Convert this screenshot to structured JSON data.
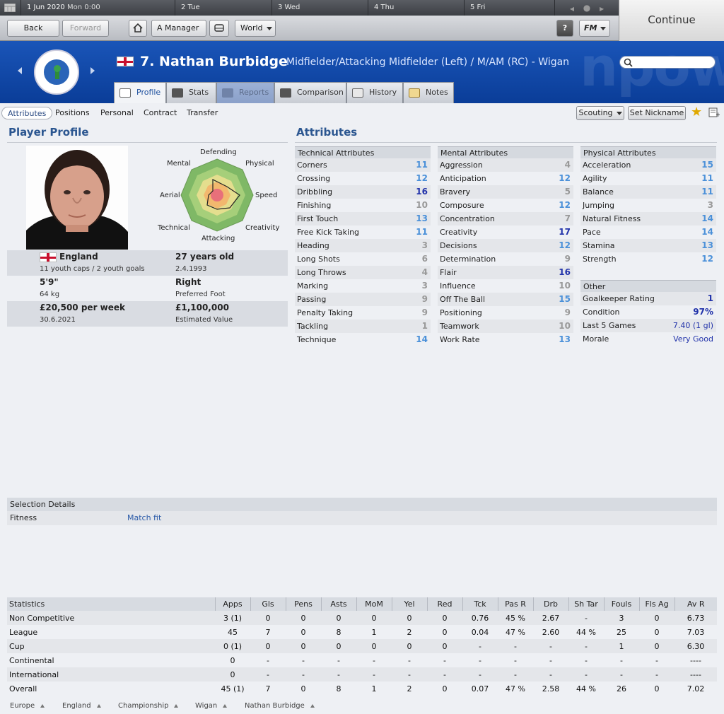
{
  "topbar": {
    "date": "1 Jun 2020",
    "time": "Mon 0:00",
    "days": [
      "2 Tue",
      "3 Wed",
      "4 Thu",
      "5 Fri"
    ],
    "continue_label": "Continue"
  },
  "nav": {
    "back": "Back",
    "forward": "Forward",
    "manager": "A Manager",
    "world": "World",
    "help": "?",
    "fm": "FM"
  },
  "header": {
    "club_crest": "WIGAN ATHLETIC",
    "player_title": "7. Nathan Burbidge",
    "position": "Midfielder/Attacking Midfielder (Left) / M/AM (RC) - Wigan",
    "watermark": "npowe",
    "tabs": [
      "Profile",
      "Stats",
      "Reports",
      "Comparison",
      "History",
      "Notes"
    ]
  },
  "subtabs": {
    "items": [
      "Attributes",
      "Positions",
      "Personal",
      "Contract",
      "Transfer"
    ],
    "scouting": "Scouting",
    "set_nickname": "Set Nickname"
  },
  "profile": {
    "title": "Player Profile",
    "radar_labels": {
      "defending": "Defending",
      "physical": "Physical",
      "speed": "Speed",
      "creativity": "Creativity",
      "attacking": "Attacking",
      "technical": "Technical",
      "aerial": "Aerial",
      "mental": "Mental"
    },
    "nationality": "England",
    "caps": "11 youth caps / 2 youth goals",
    "age": "27 years old",
    "dob": "2.4.1993",
    "height": "5'9\"",
    "weight": "64 kg",
    "foot": "Right",
    "foot_label": "Preferred Foot",
    "wage": "£20,500 per week",
    "contract_end": "30.6.2021",
    "value": "£1,100,000",
    "value_label": "Estimated Value"
  },
  "attributes": {
    "title": "Attributes",
    "technical": {
      "header": "Technical Attributes",
      "rows": [
        {
          "name": "Corners",
          "value": "11"
        },
        {
          "name": "Crossing",
          "value": "12"
        },
        {
          "name": "Dribbling",
          "value": "16"
        },
        {
          "name": "Finishing",
          "value": "10"
        },
        {
          "name": "First Touch",
          "value": "13"
        },
        {
          "name": "Free Kick Taking",
          "value": "11"
        },
        {
          "name": "Heading",
          "value": "3"
        },
        {
          "name": "Long Shots",
          "value": "6"
        },
        {
          "name": "Long Throws",
          "value": "4"
        },
        {
          "name": "Marking",
          "value": "3"
        },
        {
          "name": "Passing",
          "value": "9"
        },
        {
          "name": "Penalty Taking",
          "value": "9"
        },
        {
          "name": "Tackling",
          "value": "1"
        },
        {
          "name": "Technique",
          "value": "14"
        }
      ]
    },
    "mental": {
      "header": "Mental Attributes",
      "rows": [
        {
          "name": "Aggression",
          "value": "4"
        },
        {
          "name": "Anticipation",
          "value": "12"
        },
        {
          "name": "Bravery",
          "value": "5"
        },
        {
          "name": "Composure",
          "value": "12"
        },
        {
          "name": "Concentration",
          "value": "7"
        },
        {
          "name": "Creativity",
          "value": "17"
        },
        {
          "name": "Decisions",
          "value": "12"
        },
        {
          "name": "Determination",
          "value": "9"
        },
        {
          "name": "Flair",
          "value": "16"
        },
        {
          "name": "Influence",
          "value": "10"
        },
        {
          "name": "Off The Ball",
          "value": "15"
        },
        {
          "name": "Positioning",
          "value": "9"
        },
        {
          "name": "Teamwork",
          "value": "10"
        },
        {
          "name": "Work Rate",
          "value": "13"
        }
      ]
    },
    "physical": {
      "header": "Physical Attributes",
      "rows": [
        {
          "name": "Acceleration",
          "value": "15"
        },
        {
          "name": "Agility",
          "value": "11"
        },
        {
          "name": "Balance",
          "value": "11"
        },
        {
          "name": "Jumping",
          "value": "3"
        },
        {
          "name": "Natural Fitness",
          "value": "14"
        },
        {
          "name": "Pace",
          "value": "14"
        },
        {
          "name": "Stamina",
          "value": "13"
        },
        {
          "name": "Strength",
          "value": "12"
        }
      ]
    },
    "other": {
      "header": "Other",
      "rows": [
        {
          "name": "Goalkeeper Rating",
          "value": "1"
        },
        {
          "name": "Condition",
          "value": "97%"
        },
        {
          "name": "Last 5 Games",
          "value": "7.40 (1 gl)"
        },
        {
          "name": "Morale",
          "value": "Very Good"
        }
      ]
    }
  },
  "selection": {
    "title": "Selection Details",
    "fitness_label": "Fitness",
    "fitness_value": "Match fit"
  },
  "statistics": {
    "headers": [
      "Statistics",
      "Apps",
      "Gls",
      "Pens",
      "Asts",
      "MoM",
      "Yel",
      "Red",
      "Tck",
      "Pas R",
      "Drb",
      "Sh Tar",
      "Fouls",
      "Fls Ag",
      "Av R"
    ],
    "rows": [
      [
        "Non Competitive",
        "3 (1)",
        "0",
        "0",
        "0",
        "0",
        "0",
        "0",
        "0.76",
        "45 %",
        "2.67",
        "-",
        "3",
        "0",
        "6.73"
      ],
      [
        "League",
        "45",
        "7",
        "0",
        "8",
        "1",
        "2",
        "0",
        "0.04",
        "47 %",
        "2.60",
        "44 %",
        "25",
        "0",
        "7.03"
      ],
      [
        "Cup",
        "0 (1)",
        "0",
        "0",
        "0",
        "0",
        "0",
        "0",
        "-",
        "-",
        "-",
        "-",
        "1",
        "0",
        "6.30"
      ],
      [
        "Continental",
        "0",
        "-",
        "-",
        "-",
        "-",
        "-",
        "-",
        "-",
        "-",
        "-",
        "-",
        "-",
        "-",
        "----"
      ],
      [
        "International",
        "0",
        "-",
        "-",
        "-",
        "-",
        "-",
        "-",
        "-",
        "-",
        "-",
        "-",
        "-",
        "-",
        "----"
      ],
      [
        "Overall",
        "45 (1)",
        "7",
        "0",
        "8",
        "1",
        "2",
        "0",
        "0.07",
        "47 %",
        "2.58",
        "44 %",
        "26",
        "0",
        "7.02"
      ]
    ]
  },
  "breadcrumbs": [
    "Europe",
    "England",
    "Championship",
    "Wigan",
    "Nathan Burbidge"
  ],
  "colors": {
    "header_blue": "#0f47a8",
    "attr_dark": "#2233aa",
    "attr_light": "#4a90d9",
    "attr_grey": "#999999"
  }
}
